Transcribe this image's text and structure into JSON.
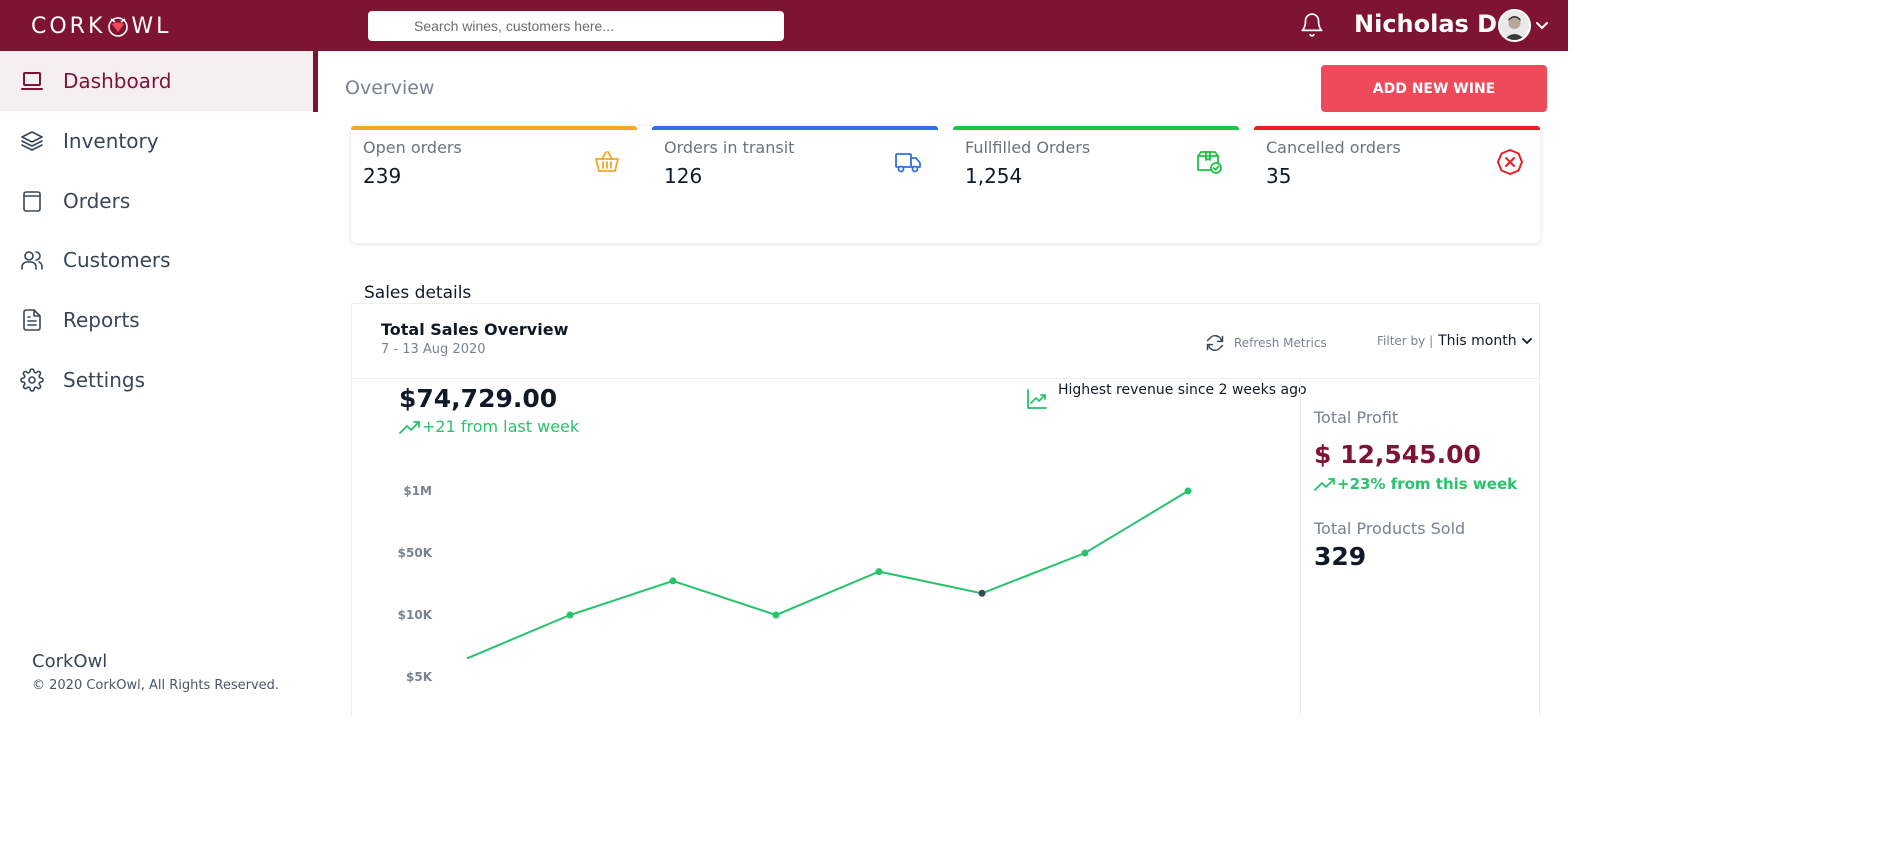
{
  "header": {
    "brand_left": "CORK",
    "brand_right": "WL",
    "search_placeholder": "Search wines, customers here...",
    "user_name": "Nicholas D."
  },
  "sidebar": {
    "items": [
      {
        "label": "Dashboard",
        "icon": "laptop-icon",
        "active": true
      },
      {
        "label": "Inventory",
        "icon": "layers-icon",
        "active": false
      },
      {
        "label": "Orders",
        "icon": "clipboard-icon",
        "active": false
      },
      {
        "label": "Customers",
        "icon": "users-icon",
        "active": false
      },
      {
        "label": "Reports",
        "icon": "document-icon",
        "active": false
      },
      {
        "label": "Settings",
        "icon": "gear-icon",
        "active": false
      }
    ],
    "footer_brand": "CorkOwl",
    "footer_copy": "© 2020 CorkOwl, All Rights Reserved."
  },
  "main": {
    "title": "Overview",
    "add_button": "ADD NEW WINE",
    "stats": [
      {
        "label": "Open orders",
        "value": "239",
        "color": "#f5a623",
        "icon": "basket-icon"
      },
      {
        "label": "Orders in transit",
        "value": "126",
        "color": "#2f6ee8",
        "icon": "truck-icon"
      },
      {
        "label": "Fullfilled Orders",
        "value": "1,254",
        "color": "#1bc447",
        "icon": "box-check-icon"
      },
      {
        "label": "Cancelled orders",
        "value": "35",
        "color": "#ee1c25",
        "icon": "cancel-circle-icon"
      }
    ],
    "sales_heading": "Sales details",
    "panel": {
      "title": "Total Sales Overview",
      "date_range": "7 - 13 Aug 2020",
      "refresh_label": "Refresh Metrics",
      "filter_label": "Filter by |",
      "filter_value": "This month",
      "total": "$74,729.00",
      "delta": "+21 from last week",
      "note": "Highest revenue since 2 weeks ago",
      "profit_label": "Total Profit",
      "profit_value": "$ 12,545.00",
      "profit_delta": "+23% from this week",
      "sold_label": "Total Products Sold",
      "sold_value": "329"
    }
  },
  "colors": {
    "brand": "#7f1334",
    "accent": "#ee4a5a",
    "positive": "#27c36a"
  },
  "chart_data": {
    "type": "line",
    "title": "",
    "y_ticks": [
      "$1M",
      "$50K",
      "$10K",
      "$5K"
    ],
    "y_scale": "categorical-log",
    "series": [
      {
        "color": "#27c36a",
        "points": [
          {
            "y_level": 2.3
          },
          {
            "y_level": 3.0
          },
          {
            "y_level": 3.55
          },
          {
            "y_level": 3.0
          },
          {
            "y_level": 3.7
          },
          {
            "y_level": 3.35,
            "highlight": true
          },
          {
            "y_level": 4.0
          },
          {
            "y_level": 5.0
          }
        ]
      }
    ]
  }
}
